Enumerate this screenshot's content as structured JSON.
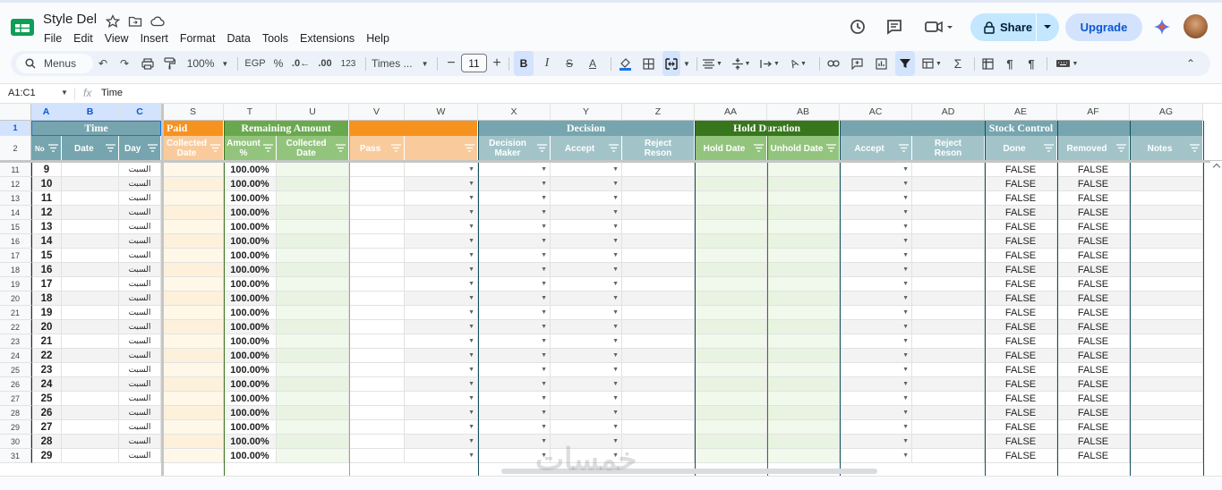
{
  "app": {
    "doc_title": "Style Del",
    "menu": [
      "File",
      "Edit",
      "View",
      "Insert",
      "Format",
      "Data",
      "Tools",
      "Extensions",
      "Help"
    ],
    "share_label": "Share",
    "upgrade_label": "Upgrade"
  },
  "toolbar": {
    "menus_label": "Menus",
    "zoom": "100%",
    "currency": "EGP",
    "percent": "%",
    "dec_decrease": ".0←",
    "dec_increase": ".00",
    "number_format": "123",
    "font": "Times ...",
    "font_size": "11",
    "bold": "B",
    "italic": "I",
    "strike": "S",
    "text_color": "A"
  },
  "formula_bar": {
    "name_box": "A1:C1",
    "fx": "fx",
    "formula": "Time"
  },
  "columns": [
    "A",
    "B",
    "C",
    "S",
    "T",
    "U",
    "V",
    "W",
    "X",
    "Y",
    "Z",
    "AA",
    "AB",
    "AC",
    "AD",
    "AE",
    "AF",
    "AG"
  ],
  "header_row_numbers": [
    "1",
    "2"
  ],
  "groups": {
    "time": "Time",
    "paid": "Paid",
    "remaining": "Remaining Amount",
    "decision": "Decision",
    "hold": "Hold Duration",
    "stock": "Stock Control"
  },
  "subheaders": {
    "no": "No",
    "date": "Date",
    "day": "Day",
    "collected_date_s": "Collected Date",
    "amount_pct": "Amount %",
    "collected_date_u": "Collected Date",
    "pass": "Pass",
    "decision_maker": "Decision Maker",
    "accept_y": "Accept",
    "reject_reson_z": "Reject Reson",
    "hold_date": "Hold Date",
    "unhold_date": "Unhold Date",
    "accept_ac": "Accept",
    "reject_reson_ad": "Reject Reson",
    "done": "Done",
    "removed": "Removed",
    "notes": "Notes"
  },
  "rows": [
    {
      "row": "11",
      "no": "9",
      "day": "السبت",
      "amount": "100.00%",
      "done": "FALSE",
      "removed": "FALSE"
    },
    {
      "row": "12",
      "no": "10",
      "day": "السبت",
      "amount": "100.00%",
      "done": "FALSE",
      "removed": "FALSE"
    },
    {
      "row": "13",
      "no": "11",
      "day": "السبت",
      "amount": "100.00%",
      "done": "FALSE",
      "removed": "FALSE"
    },
    {
      "row": "14",
      "no": "12",
      "day": "السبت",
      "amount": "100.00%",
      "done": "FALSE",
      "removed": "FALSE"
    },
    {
      "row": "15",
      "no": "13",
      "day": "السبت",
      "amount": "100.00%",
      "done": "FALSE",
      "removed": "FALSE"
    },
    {
      "row": "16",
      "no": "14",
      "day": "السبت",
      "amount": "100.00%",
      "done": "FALSE",
      "removed": "FALSE"
    },
    {
      "row": "17",
      "no": "15",
      "day": "السبت",
      "amount": "100.00%",
      "done": "FALSE",
      "removed": "FALSE"
    },
    {
      "row": "18",
      "no": "16",
      "day": "السبت",
      "amount": "100.00%",
      "done": "FALSE",
      "removed": "FALSE"
    },
    {
      "row": "19",
      "no": "17",
      "day": "السبت",
      "amount": "100.00%",
      "done": "FALSE",
      "removed": "FALSE"
    },
    {
      "row": "20",
      "no": "18",
      "day": "السبت",
      "amount": "100.00%",
      "done": "FALSE",
      "removed": "FALSE"
    },
    {
      "row": "21",
      "no": "19",
      "day": "السبت",
      "amount": "100.00%",
      "done": "FALSE",
      "removed": "FALSE"
    },
    {
      "row": "22",
      "no": "20",
      "day": "السبت",
      "amount": "100.00%",
      "done": "FALSE",
      "removed": "FALSE"
    },
    {
      "row": "23",
      "no": "21",
      "day": "السبت",
      "amount": "100.00%",
      "done": "FALSE",
      "removed": "FALSE"
    },
    {
      "row": "24",
      "no": "22",
      "day": "السبت",
      "amount": "100.00%",
      "done": "FALSE",
      "removed": "FALSE"
    },
    {
      "row": "25",
      "no": "23",
      "day": "السبت",
      "amount": "100.00%",
      "done": "FALSE",
      "removed": "FALSE"
    },
    {
      "row": "26",
      "no": "24",
      "day": "السبت",
      "amount": "100.00%",
      "done": "FALSE",
      "removed": "FALSE"
    },
    {
      "row": "27",
      "no": "25",
      "day": "السبت",
      "amount": "100.00%",
      "done": "FALSE",
      "removed": "FALSE"
    },
    {
      "row": "28",
      "no": "26",
      "day": "السبت",
      "amount": "100.00%",
      "done": "FALSE",
      "removed": "FALSE"
    },
    {
      "row": "29",
      "no": "27",
      "day": "السبت",
      "amount": "100.00%",
      "done": "FALSE",
      "removed": "FALSE"
    },
    {
      "row": "30",
      "no": "28",
      "day": "السبت",
      "amount": "100.00%",
      "done": "FALSE",
      "removed": "FALSE"
    },
    {
      "row": "31",
      "no": "29",
      "day": "السبت",
      "amount": "100.00%",
      "done": "FALSE",
      "removed": "FALSE"
    }
  ],
  "colors": {
    "teal_header": "#76a5af",
    "orange_header": "#f6921e",
    "green_header": "#6aa84f",
    "dark_green_header": "#38761d",
    "blue_sub": "#a2c4c9",
    "accent": "#0b57d0"
  }
}
